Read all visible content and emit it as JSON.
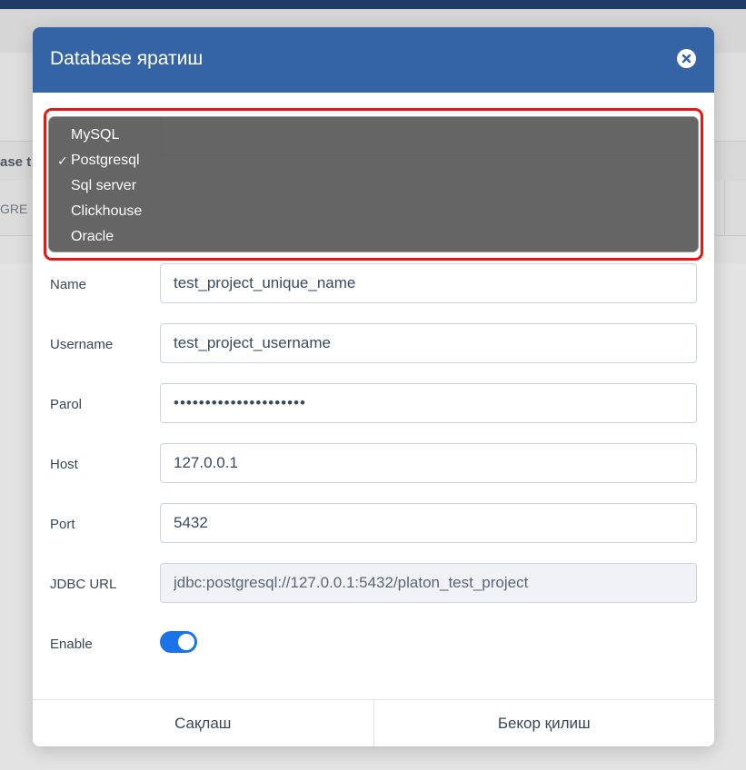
{
  "background": {
    "table_header_fragment": "ase t",
    "table_row_fragment": "GRE"
  },
  "modal": {
    "title": "Database яратиш",
    "close_icon": "close-circle-icon",
    "db_type_dropdown": {
      "options": [
        "MySQL",
        "Postgresql",
        "Sql server",
        "Clickhouse",
        "Oracle"
      ],
      "selected": "Postgresql",
      "check_glyph": "✓"
    },
    "fields": {
      "name": {
        "label": "Name",
        "value": "test_project_unique_name"
      },
      "username": {
        "label": "Username",
        "value": "test_project_username"
      },
      "password": {
        "label": "Parol",
        "value": "•••••••••••••••••••••"
      },
      "host": {
        "label": "Host",
        "value": "127.0.0.1"
      },
      "port": {
        "label": "Port",
        "value": "5432"
      },
      "jdbc_url": {
        "label": "JDBC URL",
        "value": "jdbc:postgresql://127.0.0.1:5432/platon_test_project"
      },
      "enable": {
        "label": "Enable",
        "checked": true
      }
    },
    "footer": {
      "save_label": "Сақлаш",
      "cancel_label": "Бекор қилиш"
    }
  },
  "colors": {
    "header_bg": "#3464a6",
    "toggle_on": "#1a73e8",
    "highlight_border": "#e8170f"
  }
}
